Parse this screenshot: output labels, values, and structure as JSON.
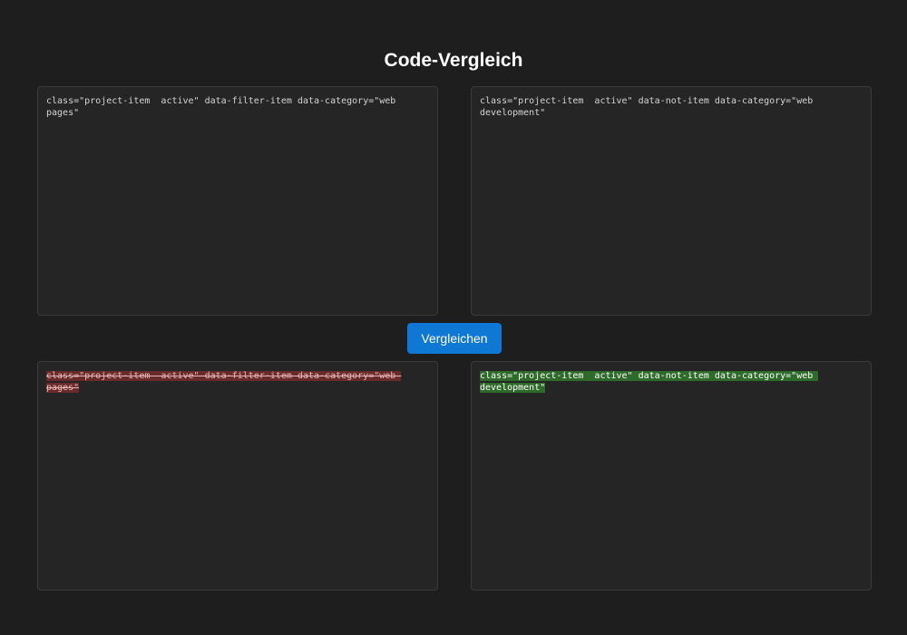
{
  "page": {
    "title": "Code-Vergleich"
  },
  "editors": {
    "left_code": "class=\"project-item  active\" data-filter-item data-category=\"web pages\"",
    "right_code": "class=\"project-item  active\" data-not-item data-category=\"web development\""
  },
  "compare_button": {
    "label": "Vergleichen"
  },
  "result": {
    "left_removed": "class=\"project-item  active\" data-filter-item data-category=\"web pages\"",
    "right_added": "class=\"project-item  active\" data-not-item data-category=\"web development\""
  },
  "colors": {
    "background": "#1e1e1e",
    "panel": "#252526",
    "accent": "#0e78d4",
    "removed_highlight": "#6b2a2a",
    "added_highlight": "#2e6b2a"
  }
}
